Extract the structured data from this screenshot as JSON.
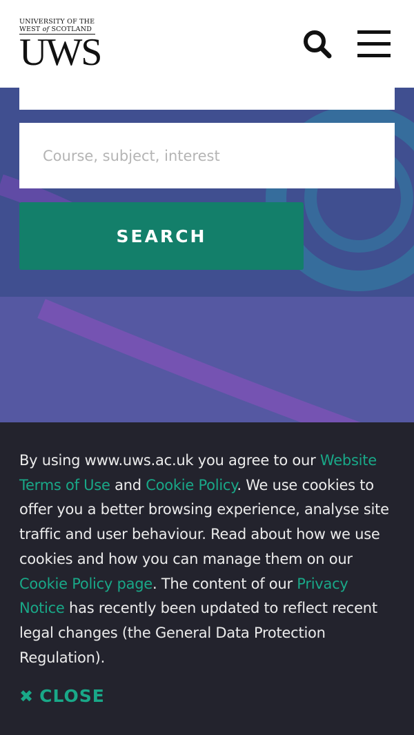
{
  "header": {
    "logo": {
      "line1": "UNIVERSITY OF THE",
      "line2_a": "WEST",
      "line2_of": "of",
      "line2_b": "SCOTLAND",
      "mark": "UWS"
    },
    "icons": {
      "search": "search-icon",
      "menu": "hamburger-menu-icon"
    }
  },
  "search": {
    "placeholder": "Course, subject, interest",
    "button_label": "SEARCH"
  },
  "cookie": {
    "t1": "By using www.uws.ac.uk you agree to our ",
    "link_terms": "Website Terms of Use",
    "t2": " and ",
    "link_cookie_policy": "Cookie Policy",
    "t3": ".  We use cookies to offer you a better browsing experience, analyse site traffic and user behaviour.  Read about how we use cookies and how you can manage them on our ",
    "link_cookie_page": "Cookie Policy page",
    "t4": ".  The content of our ",
    "link_privacy": "Privacy Notice",
    "t5": " has recently been updated to reflect recent legal changes (the General Data Protection Regulation).",
    "close_icon": "close-icon",
    "close_label": "CLOSE"
  },
  "colors": {
    "accent": "#137f6a",
    "link": "#19a888",
    "banner_bg": "#23232d",
    "hero_bg": "#404f90"
  }
}
